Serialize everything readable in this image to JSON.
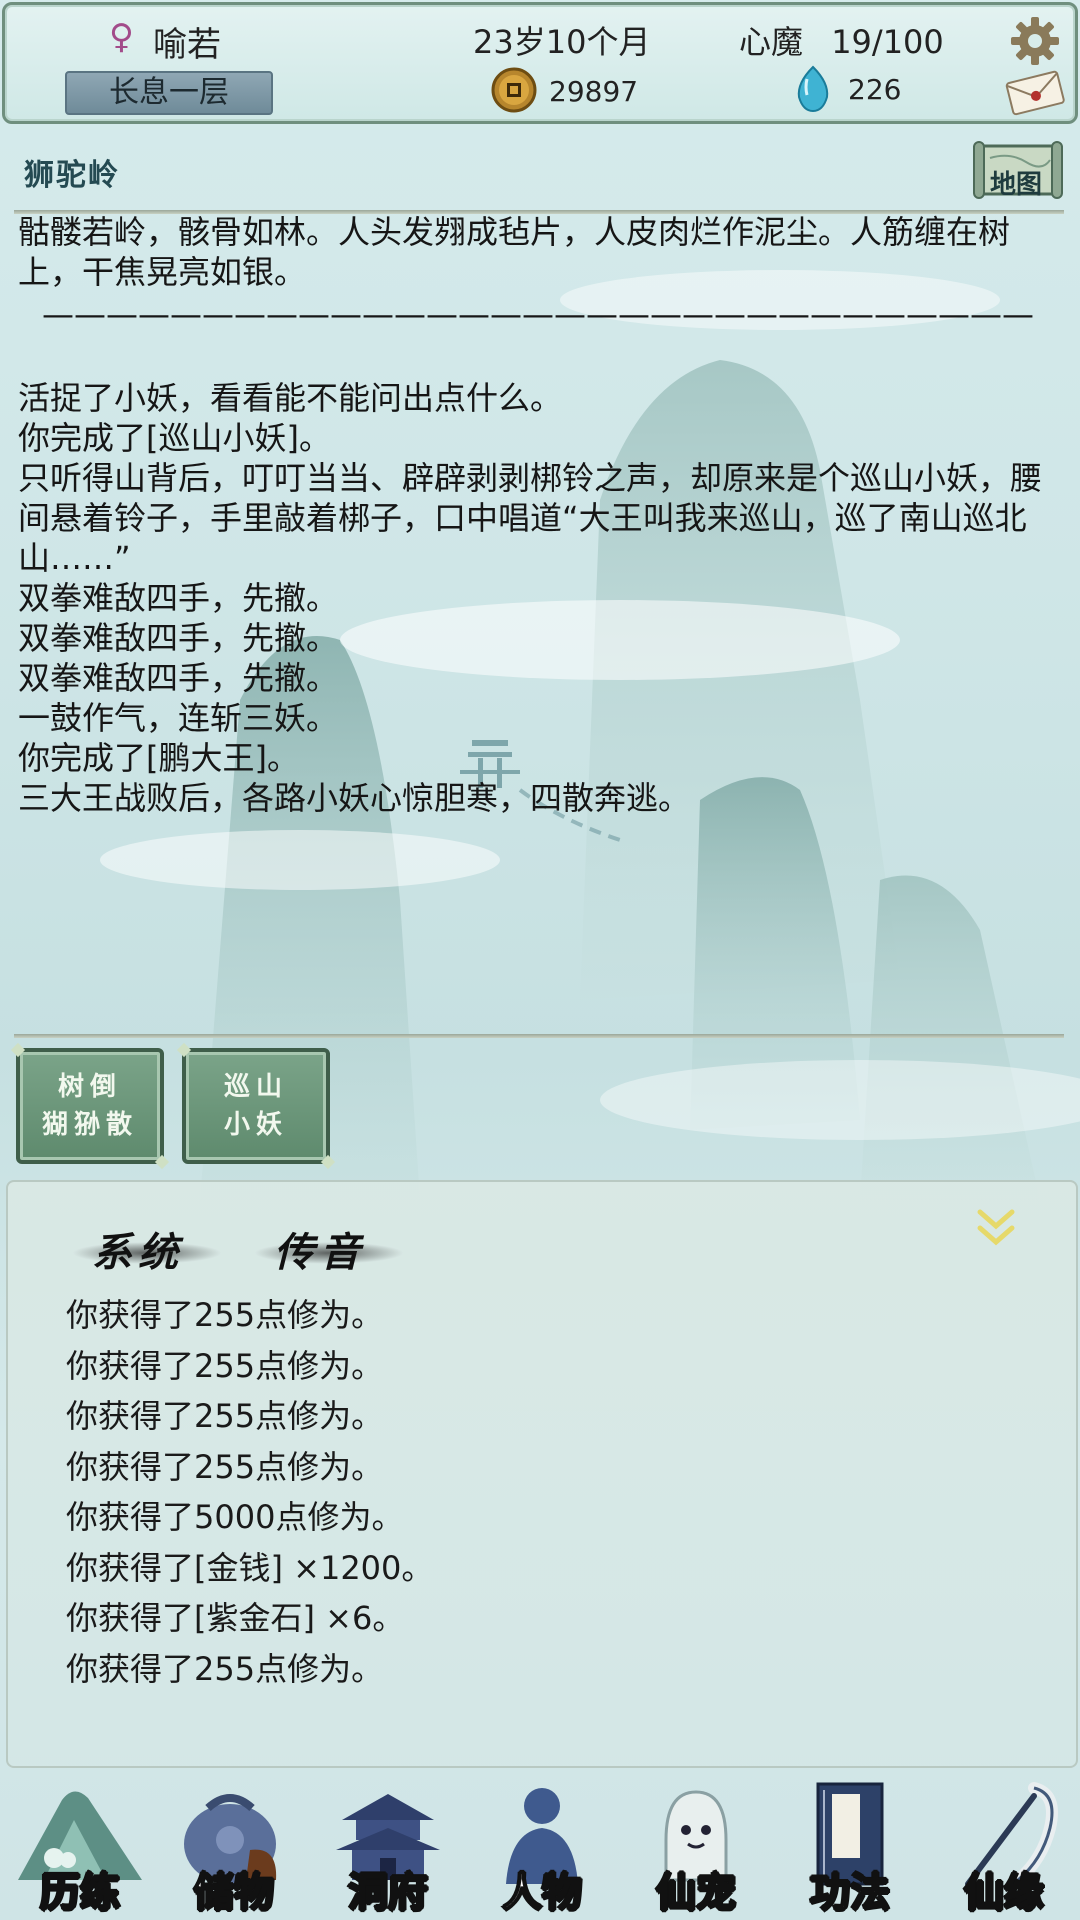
{
  "status": {
    "gender_symbol": "♀",
    "player_name": "喻若",
    "realm": "长息一层",
    "age": "23岁10个月",
    "heart_demon_label": "心魔",
    "heart_demon_value": "19/100",
    "coins": "29897",
    "gems": "226",
    "icons": [
      "gear-icon",
      "mail-icon",
      "coin-icon",
      "gem-icon"
    ]
  },
  "location": {
    "name": "狮驼岭",
    "map_label": "地图"
  },
  "story": {
    "intro": "骷髅若岭，骸骨如林。人头发翙成毡片，人皮肉烂作泥尘。人筋缠在树上，干焦晃亮如银。",
    "separator": "———————————————————————————————",
    "lines": [
      "活捉了小妖，看看能不能问出点什么。",
      "你完成了[巡山小妖]。",
      "只听得山背后，叮叮当当、辟辟剥剥梆铃之声，却原来是个巡山小妖，腰间悬着铃子，手里敲着梆子，口中唱道“大王叫我来巡山，巡了南山巡北山……”",
      "双拳难敌四手，先撤。",
      "双拳难敌四手，先撤。",
      "双拳难敌四手，先撤。",
      "一鼓作气，连斩三妖。",
      "你完成了[鹏大王]。",
      "三大王战败后，各路小妖心惊胆寒，四散奔逃。"
    ]
  },
  "actions": {
    "button1_line1": "树倒",
    "button1_line2": "猢狲散",
    "button2_line1": "巡山",
    "button2_line2": "小妖"
  },
  "log": {
    "tab_system": "系统",
    "tab_whisper": "传音",
    "lines": [
      "你获得了255点修为。",
      "你获得了255点修为。",
      "你获得了255点修为。",
      "你获得了255点修为。",
      "你获得了5000点修为。",
      "你获得了[金钱] ×1200。",
      "你获得了[紫金石] ×6。",
      "你获得了255点修为。"
    ]
  },
  "nav": {
    "items": [
      "历练",
      "储物",
      "洞府",
      "人物",
      "仙宠",
      "功法",
      "仙缘"
    ]
  },
  "colors": {
    "background": "#cfe6e7",
    "bar_border": "#6f8f7e",
    "button_green": "#6a977a",
    "realm_badge": "#7e98a6"
  }
}
